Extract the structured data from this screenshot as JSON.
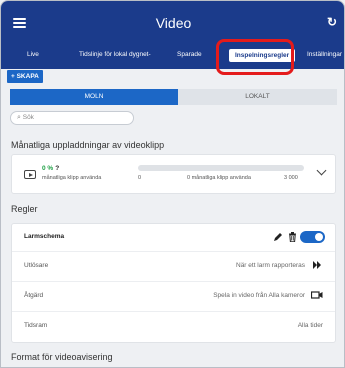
{
  "header": {
    "title": "Video",
    "refresh_icon": "refresh-icon",
    "menu_icon": "hamburger-menu-icon"
  },
  "tabs": [
    {
      "label": "Live"
    },
    {
      "label": "Tidslinje för lokal dygnet-"
    },
    {
      "label": "Sparade"
    },
    {
      "label": "Inspelningsregler",
      "active": true
    },
    {
      "label": "Inställningar"
    }
  ],
  "create_button": "+ SKAPA",
  "segment": {
    "cloud": "MOLN",
    "local": "LOKALT"
  },
  "search": {
    "placeholder": "Sök"
  },
  "monthly": {
    "title": "Månatliga uppladdningar av videoklipp",
    "percent": "0 %",
    "help": "?",
    "used_label": "månatliga klipp använda",
    "min": "0",
    "mid_label": "0 månatliga klipp använda",
    "max": "3 000",
    "usage_fraction": 0
  },
  "rules": {
    "title": "Regler",
    "rule": {
      "name": "Larmschema",
      "enabled": true,
      "trigger_label": "Utlösare",
      "trigger_value": "När ett larm rapporteras",
      "action_label": "Åtgärd",
      "action_value": "Spela in video från Alla kameror",
      "schedule_label": "Tidsram",
      "schedule_value": "Alla tider"
    }
  },
  "format_title": "Format för videoavisering",
  "colors": {
    "header": "#1b3b8b",
    "accent": "#1c67c6",
    "highlight": "#e41b1b",
    "good": "#1fa045"
  }
}
